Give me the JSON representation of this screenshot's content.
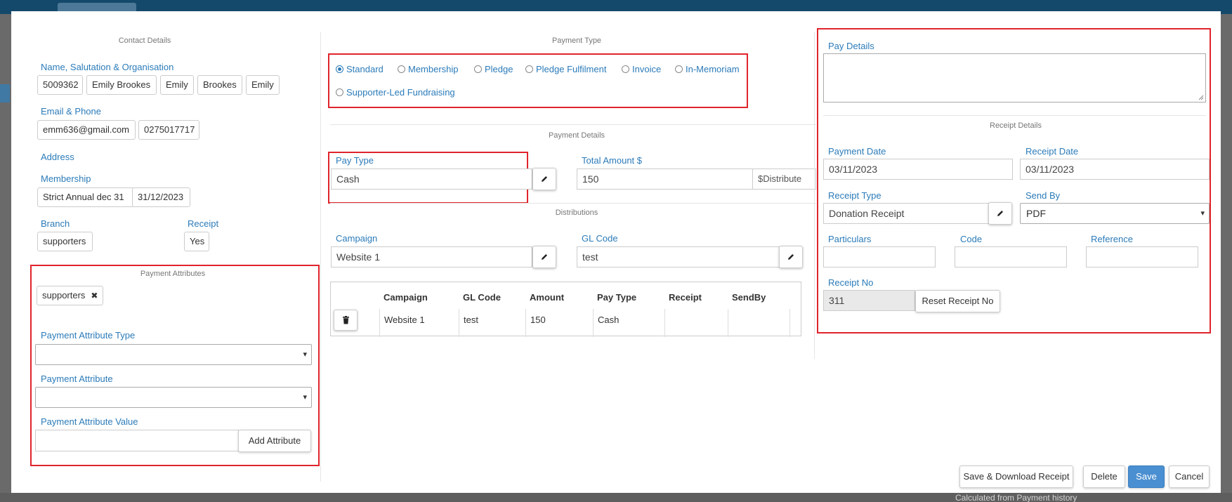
{
  "background": {
    "bottom_text": "Calculated from Payment history"
  },
  "contact": {
    "section_title": "Contact Details",
    "name_label": "Name, Salutation & Organisation",
    "name_values": [
      "5009362",
      "Emily Brookes",
      "Emily",
      "Brookes",
      "Emily"
    ],
    "email_phone_label": "Email & Phone",
    "email": "emm636@gmail.com",
    "phone": "0275017717",
    "address_label": "Address",
    "membership_label": "Membership",
    "membership_values": [
      "Strict Annual dec 31",
      "31/12/2023"
    ],
    "branch_label": "Branch",
    "branch_value": "supporters",
    "receipt_label": "Receipt",
    "receipt_value": "Yes"
  },
  "payment_attributes": {
    "section_title": "Payment Attributes",
    "tag": "supporters",
    "type_label": "Payment Attribute Type",
    "type_value": "",
    "attribute_label": "Payment Attribute",
    "attribute_value": "",
    "value_label": "Payment Attribute Value",
    "value_input": "",
    "add_button": "Add Attribute"
  },
  "payment_type": {
    "section_title": "Payment Type",
    "options": [
      "Standard",
      "Membership",
      "Pledge",
      "Pledge Fulfilment",
      "Invoice",
      "In-Memoriam",
      "Supporter-Led Fundraising"
    ],
    "selected": "Standard"
  },
  "payment_details": {
    "section_title": "Payment Details",
    "pay_type_label": "Pay Type",
    "pay_type_value": "Cash",
    "total_label": "Total Amount $",
    "total_value": "150",
    "distribute_label": "$Distribute"
  },
  "distributions": {
    "section_title": "Distributions",
    "campaign_label": "Campaign",
    "campaign_value": "Website 1",
    "gl_label": "GL Code",
    "gl_value": "test",
    "columns": [
      "Campaign",
      "GL Code",
      "Amount",
      "Pay Type",
      "Receipt",
      "SendBy"
    ],
    "rows": [
      {
        "campaign": "Website 1",
        "gl_code": "test",
        "amount": "150",
        "pay_type": "Cash",
        "receipt": "",
        "sendby": ""
      }
    ]
  },
  "pay_details": {
    "label": "Pay Details",
    "value": ""
  },
  "receipt_details": {
    "section_title": "Receipt Details",
    "payment_date_label": "Payment Date",
    "payment_date": "03/11/2023",
    "receipt_date_label": "Receipt Date",
    "receipt_date": "03/11/2023",
    "receipt_type_label": "Receipt Type",
    "receipt_type": "Donation Receipt",
    "send_by_label": "Send By",
    "send_by": "PDF",
    "particulars_label": "Particulars",
    "particulars": "",
    "code_label": "Code",
    "code": "",
    "reference_label": "Reference",
    "reference": "",
    "receipt_no_label": "Receipt No",
    "receipt_no": "311",
    "reset_button": "Reset Receipt No"
  },
  "footer": {
    "save_download": "Save & Download Receipt",
    "delete": "Delete",
    "save": "Save",
    "cancel": "Cancel"
  },
  "colors": {
    "accent_label": "#2b7bb9",
    "primary_button": "#4a8fd1",
    "highlight_box": "#e0242c"
  }
}
